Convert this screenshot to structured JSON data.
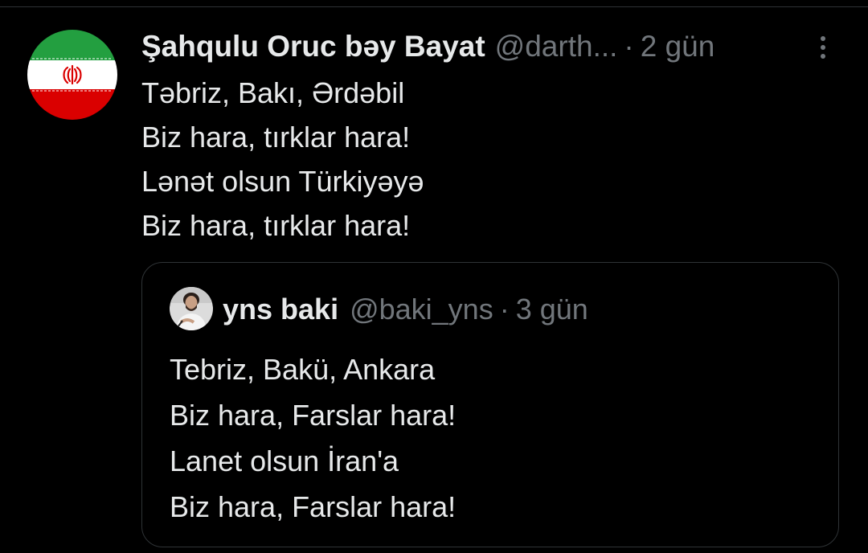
{
  "tweet": {
    "author_name": "Şahqulu Oruc bəy Bayat",
    "author_handle": "@darth...",
    "separator": "·",
    "time": "2 gün",
    "avatar_icon": "iran-flag-icon",
    "lines": [
      "Təbriz, Bakı, Ərdəbil",
      "Biz hara, tırklar hara!",
      "Lənət olsun Türkiyəyə",
      "Biz hara, tırklar hara!"
    ]
  },
  "quote": {
    "author_name": "yns baki",
    "author_handle": "@baki_yns",
    "separator": "·",
    "time": "3 gün",
    "lines": [
      "Tebriz, Bakü, Ankara",
      "Biz hara, Farslar hara!",
      "Lanet olsun İran'a",
      "Biz hara, Farslar hara!"
    ]
  },
  "colors": {
    "background": "#000000",
    "text_primary": "#e7e9ea",
    "text_secondary": "#71767b",
    "border": "#2f3336",
    "flag_green": "#239f40",
    "flag_white": "#ffffff",
    "flag_red": "#da0000"
  }
}
